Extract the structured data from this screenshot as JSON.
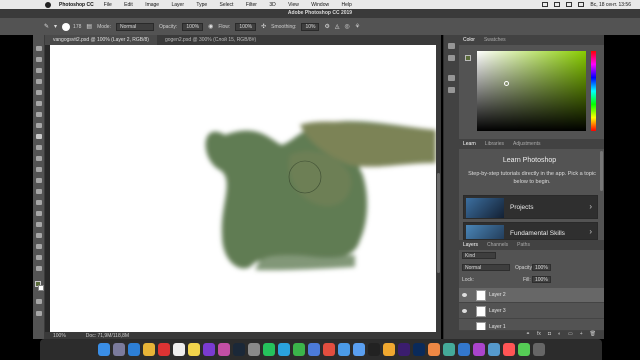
{
  "menubar": {
    "app_name": "Photoshop CC",
    "items": [
      "File",
      "Edit",
      "Image",
      "Layer",
      "Type",
      "Select",
      "Filter",
      "3D",
      "View",
      "Window",
      "Help"
    ],
    "clock": "Вс, 18 сент.  13:56"
  },
  "window": {
    "title": "Adobe Photoshop CC 2019"
  },
  "options": {
    "brush_size": "178",
    "mode_label": "Mode:",
    "mode_value": "Normal",
    "opacity_label": "Opacity:",
    "opacity_value": "100%",
    "flow_label": "Flow:",
    "flow_value": "100%",
    "smoothing_label": "Smoothing:",
    "smoothing_value": "10%"
  },
  "doc_tabs": [
    {
      "label": "vangogsvit2.psd @ 100% (Layer 2, RGB/8)",
      "active": true
    },
    {
      "label": "gogen2.psd @ 300% (Слой 15, RGB/8#)",
      "active": false
    }
  ],
  "status": {
    "zoom": "100%",
    "doc_size": "Doc: 71,9M/118,8M"
  },
  "colors": {
    "foreground": "#5a6b3a",
    "background": "#ffffff",
    "stroke": "#627d56",
    "accent": "#3b8fd9"
  },
  "color_panel": {
    "tabs": [
      "Color",
      "Swatches"
    ],
    "active_tab": "Color"
  },
  "learn_panel": {
    "tabs": [
      "Learn",
      "Libraries",
      "Adjustments"
    ],
    "active_tab": "Learn",
    "title": "Learn Photoshop",
    "description": "Step-by-step tutorials directly in the app. Pick a topic below to begin.",
    "cards": [
      {
        "label": "Projects"
      },
      {
        "label": "Fundamental Skills"
      }
    ]
  },
  "layers_panel": {
    "tabs": [
      "Layers",
      "Channels",
      "Paths"
    ],
    "active_tab": "Layers",
    "kind_label": "Kind",
    "blend_mode": "Normal",
    "opacity_label": "Opacity:",
    "opacity_value": "100%",
    "lock_label": "Lock:",
    "fill_label": "Fill:",
    "fill_value": "100%",
    "layers": [
      {
        "name": "Layer 2",
        "selected": true
      },
      {
        "name": "Layer 3",
        "selected": false
      },
      {
        "name": "Layer 1",
        "selected": false
      }
    ]
  },
  "dock": {
    "apps": [
      "finder",
      "launchpad",
      "safari",
      "chrome",
      "opera",
      "calendar",
      "notes",
      "onenote",
      "affinity",
      "steam",
      "settings",
      "whatsapp",
      "telegram",
      "torrent",
      "vpn",
      "video",
      "files",
      "mail",
      "max",
      "photos",
      "ae",
      "ps",
      "app-a",
      "app-b",
      "app-c",
      "app-d",
      "finder-2",
      "music",
      "editor",
      "trash"
    ]
  }
}
